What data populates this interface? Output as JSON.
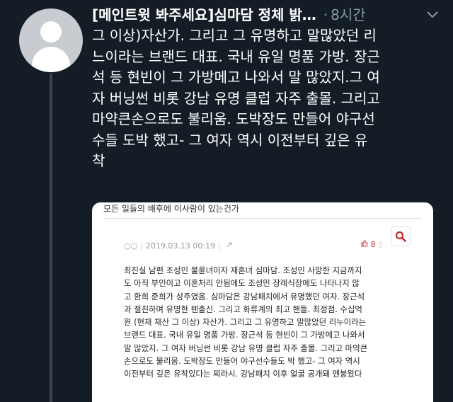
{
  "tweet": {
    "title": "[메인트윗 봐주세요]심마담 정체 밝…",
    "dot": "·",
    "time": "8시간",
    "lines": [
      "그 이상)자산가. 그리고 그 유명하고 말많았던 리",
      "느이라는 브랜드 대표. 국내 유일 명품 가방. 장근",
      "석 등 현빈이 그 가방메고 나와서 말 많았지.그 여",
      "자 버닝썬 비롯 강남 유명 클럽 자주 출몰. 그리고",
      "마약큰손으로도 불리움. 도박장도 만들어 야구선",
      "수들 도박 했고- 그 여자 역시 이전부터 깊은 유",
      "착"
    ]
  },
  "media": {
    "title": "모든 일들의 배후에 이사람이 있는건가",
    "meta_dots": "○○",
    "date": "2019.03.13 00:19",
    "likes": "8",
    "body_lines": [
      "최진실 남편 조성민 불륜녀이자 재혼녀 심마담. 조성민 사망한 지금까지",
      "도 아직 부인이고 이혼처리 안됨에도 조성민 장례식장에도 나타나지 않",
      "고 환희 준희가 상주였음. 심마담은 강남패치에서 유명했던 여자. 장근석",
      "과 절친하며 유명한 텐출신. 그리고 화류계의 최고 핸들. 최정점. 수십억",
      "원 (현재 재산 그 이상) 자산가. 그리고 그 유명하고 말많았던 리누이라는",
      "브랜드 대표. 국내 유일 명품 가방. 장근석 등 현빈이 그 가방메고 나와서",
      "말 많았지. 그 여자 버닝썬 비롯 강남 유명 클럽 자주 출몰. 그리고 마약큰",
      "손으로도 불리움. 도박장도 만들어 야구선수들도 박 했고- 그 여자 역시",
      "이전부터 깊은 유착있다는 찌라시. 강남패치 이후 얼굴 공개돼 멘붕왔다"
    ]
  },
  "colors": {
    "background": "#141d26",
    "secondary_text": "#8899a6",
    "accent_red": "#d32f2f"
  }
}
